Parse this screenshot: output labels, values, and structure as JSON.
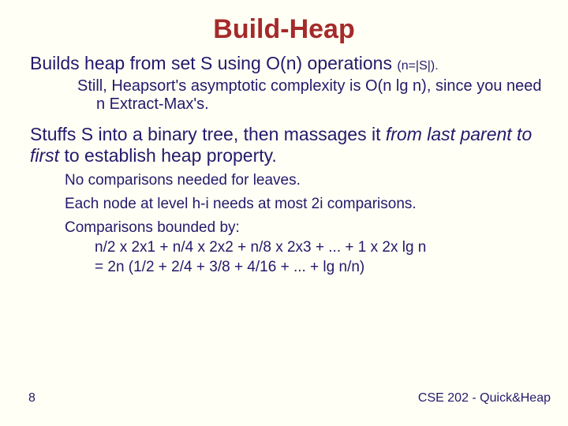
{
  "title": "Build-Heap",
  "p1": {
    "main": "Builds heap from set S using O(n) operations ",
    "note": "(n=|S|).",
    "sub": "Still, Heapsort's asymptotic complexity is O(n lg n), since you need n Extract-Max's."
  },
  "p2": {
    "pre": "Stuffs S into a binary tree, then massages it ",
    "em": "from last parent to first",
    "post": " to establish heap property.",
    "b1": "No comparisons needed for leaves.",
    "b2": "Each node at level h-i needs at most 2i comparisons.",
    "b3": "Comparisons bounded by:",
    "eq1": "n/2 x 2x1 + n/4 x 2x2 + n/8 x 2x3 + ... + 1 x 2x lg n",
    "eq2": "=  2n (1/2 + 2/4 + 3/8 + 4/16 + ... + lg n/n)"
  },
  "footer": {
    "page": "8",
    "course": "CSE 202 - Quick&Heap"
  }
}
